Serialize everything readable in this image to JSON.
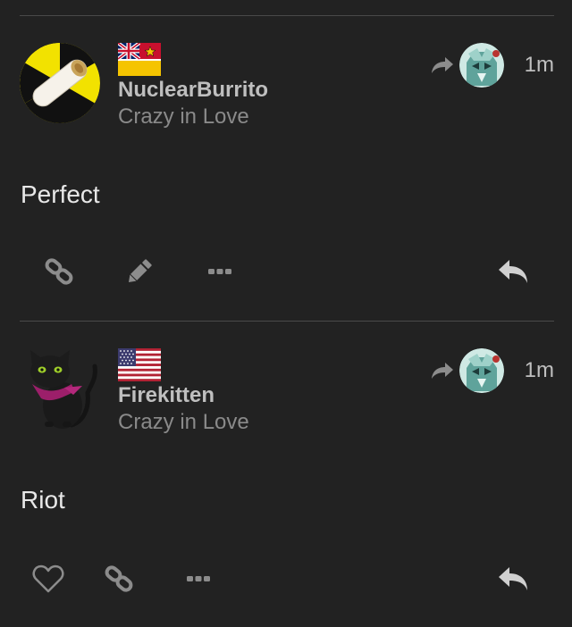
{
  "posts": [
    {
      "username": "NuclearBurrito",
      "topic": "Crazy in Love",
      "time": "1m",
      "body": "Perfect",
      "flag": "mauritius-like-flag-icon",
      "avatar": "radiation-burrito-avatar",
      "actions": [
        "link-icon",
        "edit-pencil-icon",
        "more-dots-icon",
        "reply-icon"
      ]
    },
    {
      "username": "Firekitten",
      "topic": "Crazy in Love",
      "time": "1m",
      "body": "Riot",
      "flag": "us-flag-icon",
      "avatar": "black-cat-avatar",
      "actions": [
        "like-heart-icon",
        "link-icon",
        "more-dots-icon",
        "reply-icon"
      ]
    }
  ],
  "colors": {
    "background": "#222222",
    "divider": "#4a4a4a",
    "username": "#bfbfbf",
    "topic": "#8a8a8a",
    "icon": "#8c8c8c",
    "reply_icon": "#d0d0d0"
  }
}
